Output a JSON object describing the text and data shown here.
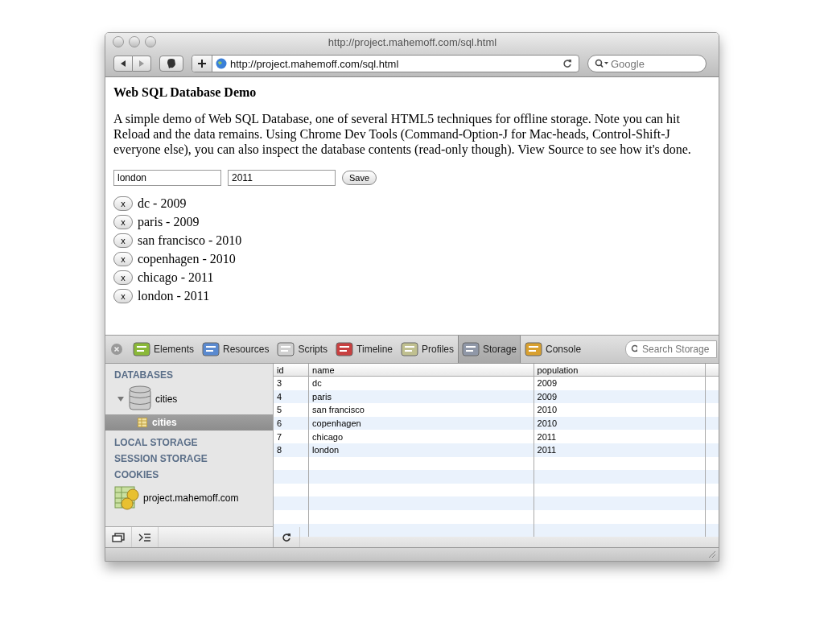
{
  "window": {
    "title": "http://project.mahemoff.com/sql.html"
  },
  "toolbar": {
    "address": "http://project.mahemoff.com/sql.html",
    "search": {
      "placeholder": "Google"
    }
  },
  "page": {
    "heading": "Web SQL Database Demo",
    "intro": "A simple demo of Web SQL Database, one of several HTML5 techniques for offline storage. Note you can hit Reload and the data remains. Using Chrome Dev Tools (Command-Option-J for Mac-heads, Control-Shift-J everyone else), you can also inspect the database contents (read-only though). View Source to see how it's done.",
    "form": {
      "name_value": "london",
      "year_value": "2011",
      "save_button": "Save"
    },
    "entries": [
      {
        "delete": "x",
        "text": "dc - 2009"
      },
      {
        "delete": "x",
        "text": "paris - 2009"
      },
      {
        "delete": "x",
        "text": "san francisco - 2010"
      },
      {
        "delete": "x",
        "text": "copenhagen - 2010"
      },
      {
        "delete": "x",
        "text": "chicago - 2011"
      },
      {
        "delete": "x",
        "text": "london - 2011"
      }
    ]
  },
  "devtools": {
    "tabs": [
      {
        "label": "Elements",
        "kind": "elements",
        "selected": false
      },
      {
        "label": "Resources",
        "kind": "resources",
        "selected": false
      },
      {
        "label": "Scripts",
        "kind": "scripts",
        "selected": false
      },
      {
        "label": "Timeline",
        "kind": "timeline",
        "selected": false
      },
      {
        "label": "Profiles",
        "kind": "profiles",
        "selected": false
      },
      {
        "label": "Storage",
        "kind": "storage",
        "selected": true
      },
      {
        "label": "Console",
        "kind": "console",
        "selected": false
      }
    ],
    "search": {
      "placeholder": "Search Storage"
    },
    "sidebar": [
      {
        "title": "DATABASES",
        "items": [
          {
            "label": "cities",
            "kind": "database",
            "expanded": true,
            "selected": false,
            "children": [
              {
                "label": "cities",
                "kind": "table",
                "selected": true
              }
            ]
          }
        ]
      },
      {
        "title": "LOCAL STORAGE"
      },
      {
        "title": "SESSION STORAGE"
      },
      {
        "title": "COOKIES",
        "items": [
          {
            "label": "project.mahemoff.com",
            "kind": "cookie",
            "selected": false
          }
        ]
      }
    ],
    "table": {
      "columns": [
        "id",
        "name",
        "population"
      ],
      "rows": [
        [
          "3",
          "dc",
          "2009"
        ],
        [
          "4",
          "paris",
          "2009"
        ],
        [
          "5",
          "san francisco",
          "2010"
        ],
        [
          "6",
          "copenhagen",
          "2010"
        ],
        [
          "7",
          "chicago",
          "2011"
        ],
        [
          "8",
          "london",
          "2011"
        ]
      ]
    }
  }
}
